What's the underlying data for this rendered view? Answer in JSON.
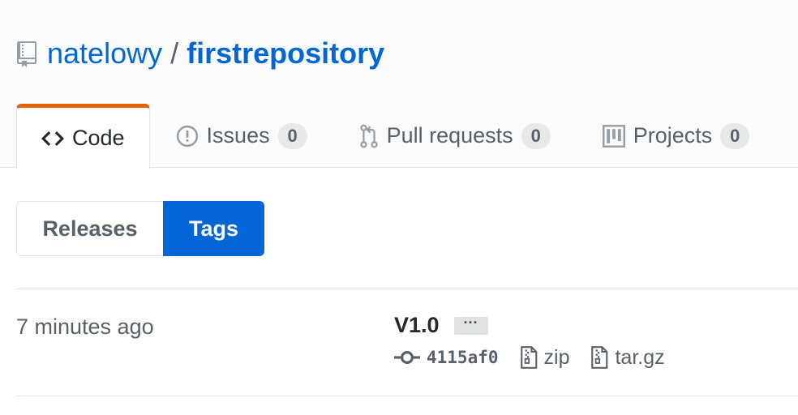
{
  "repo": {
    "owner": "natelowy",
    "separator": "/",
    "name": "firstrepository",
    "icon": "repo-icon"
  },
  "tabs": [
    {
      "label": "Code",
      "icon": "code-icon",
      "selected": true
    },
    {
      "label": "Issues",
      "icon": "issue-opened-icon",
      "count": "0"
    },
    {
      "label": "Pull requests",
      "icon": "git-pull-request-icon",
      "count": "0"
    },
    {
      "label": "Projects",
      "icon": "project-icon",
      "count": "0"
    }
  ],
  "subnav": {
    "releases_label": "Releases",
    "tags_label": "Tags",
    "selected": "Tags"
  },
  "tag": {
    "date": "7 minutes ago",
    "name": "V1.0",
    "more_label": "···",
    "commit_sha": "4115af0",
    "zip_label": "zip",
    "tar_label": "tar.gz"
  },
  "colors": {
    "link": "#0366d6",
    "selected_tab_accent": "#e36209",
    "selected_subnav_bg": "#0366d6",
    "muted_text": "#586069"
  }
}
